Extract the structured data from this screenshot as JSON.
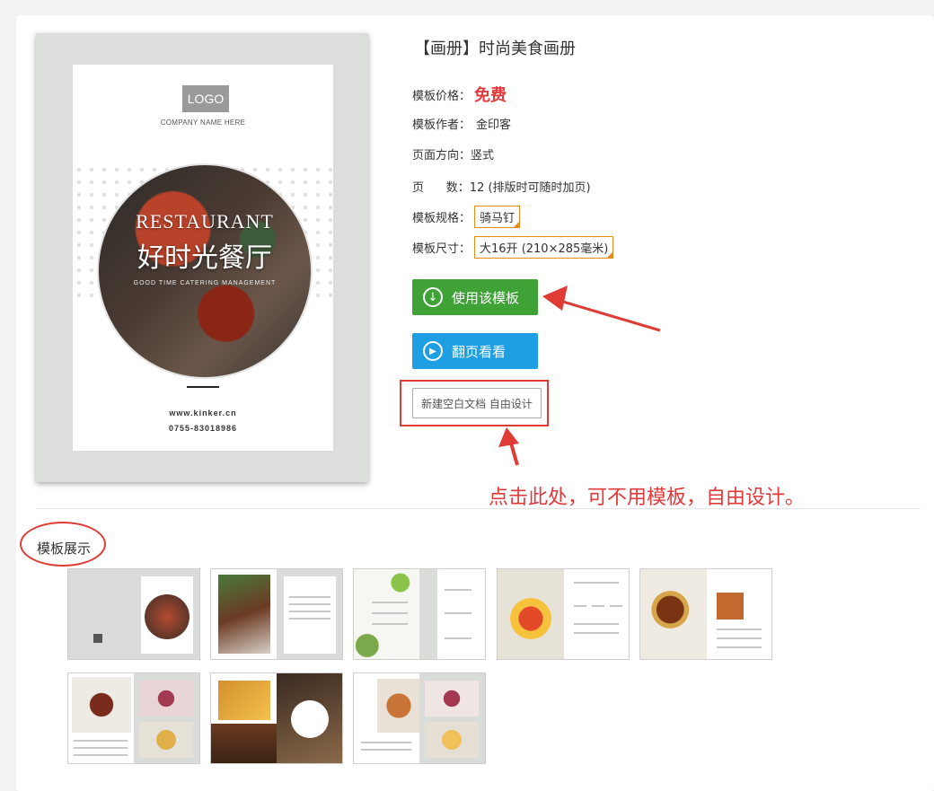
{
  "product": {
    "title": "【画册】时尚美食画册",
    "price_label": "模板价格：",
    "price_value": "免费",
    "author_label": "模板作者：",
    "author_value": "金印客",
    "orientation_label": "页面方向：",
    "orientation_value": "竖式",
    "pages_label": "页      数：",
    "pages_value": "12 (排版时可随时加页)",
    "spec_label": "模板规格：",
    "spec_value": "骑马钉",
    "size_label": "模板尺寸：",
    "size_value": "大16开 (210×285毫米)"
  },
  "cover": {
    "logo": "LOGO",
    "company": "COMPANY  NAME  HERE",
    "hero_en": "RESTAURANT",
    "hero_cn": "好时光餐厅",
    "hero_sub": "GOOD TIME CATERING MANAGEMENT",
    "website": "www.kinker.cn",
    "phone": "0755-83018986"
  },
  "buttons": {
    "use_template": "使用该模板",
    "flip_view": "翻页看看",
    "blank_doc": "新建空白文档 自由设计"
  },
  "annotation": {
    "note": "点击此处，可不用模板，自由设计。"
  },
  "section": {
    "title": "模板展示"
  },
  "colors": {
    "green": "#3ea236",
    "blue": "#1e9ee3",
    "red": "#e3393a",
    "orange": "#e58a19"
  }
}
